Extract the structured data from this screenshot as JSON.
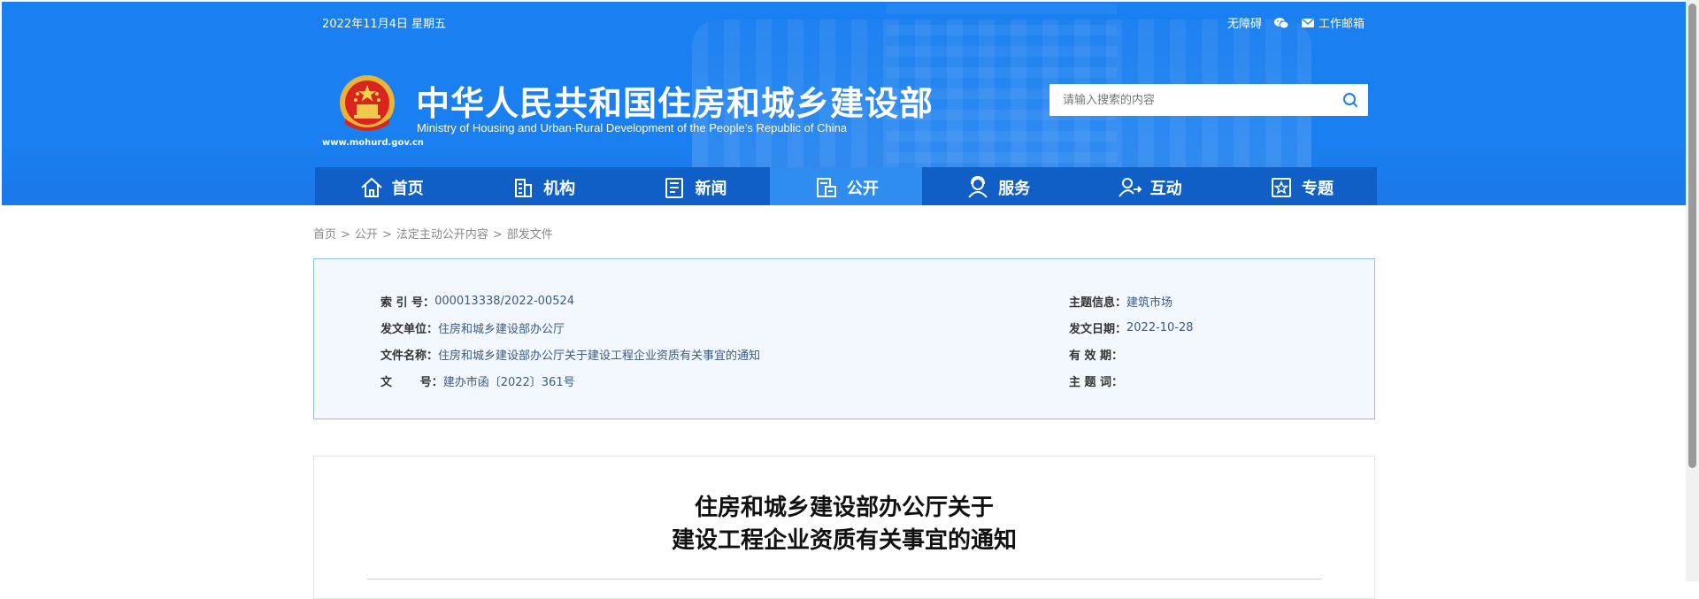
{
  "header": {
    "date": "2022年11月4日 星期五",
    "top_links": {
      "accessibility": "无障碍",
      "wechat_icon": "wechat-icon",
      "email_label": "工作邮箱"
    },
    "site_url": "www.mohurd.gov.cn",
    "title_cn": "中华人民共和国住房和城乡建设部",
    "title_en": "Ministry of Housing and Urban-Rural Development of the People’s Republic of China",
    "search_placeholder": "请输入搜索的内容"
  },
  "nav": {
    "items": [
      {
        "label": "首页",
        "icon": "home-icon"
      },
      {
        "label": "机构",
        "icon": "building-icon"
      },
      {
        "label": "新闻",
        "icon": "news-icon"
      },
      {
        "label": "公开",
        "icon": "disclosure-icon",
        "active": true
      },
      {
        "label": "服务",
        "icon": "service-icon"
      },
      {
        "label": "互动",
        "icon": "interaction-icon"
      },
      {
        "label": "专题",
        "icon": "star-icon"
      }
    ]
  },
  "breadcrumb": [
    "首页",
    "公开",
    "法定主动公开内容",
    "部发文件"
  ],
  "meta": {
    "left": [
      {
        "label": "索 引 号：",
        "value": "000013338/2022-00524"
      },
      {
        "label": "发文单位：",
        "value": "住房和城乡建设部办公厅"
      },
      {
        "label": "文件名称：",
        "value": "住房和城乡建设部办公厅关于建设工程企业资质有关事宜的通知"
      },
      {
        "label": "文       号：",
        "value": "建办市函〔2022〕361号"
      }
    ],
    "right": [
      {
        "label": "主题信息：",
        "value": "建筑市场"
      },
      {
        "label": "发文日期：",
        "value": "2022-10-28"
      },
      {
        "label": "有 效 期：",
        "value": ""
      },
      {
        "label": "主 题 词：",
        "value": ""
      }
    ]
  },
  "article": {
    "title_line1": "住房和城乡建设部办公厅关于",
    "title_line2": "建设工程企业资质有关事宜的通知"
  },
  "colors": {
    "header_blue": "#1a7ff0",
    "nav_blue": "#0f5fc7",
    "nav_active": "#2f8cf0",
    "meta_bg": "#f3f8fe",
    "meta_border": "#8cc1ea"
  }
}
